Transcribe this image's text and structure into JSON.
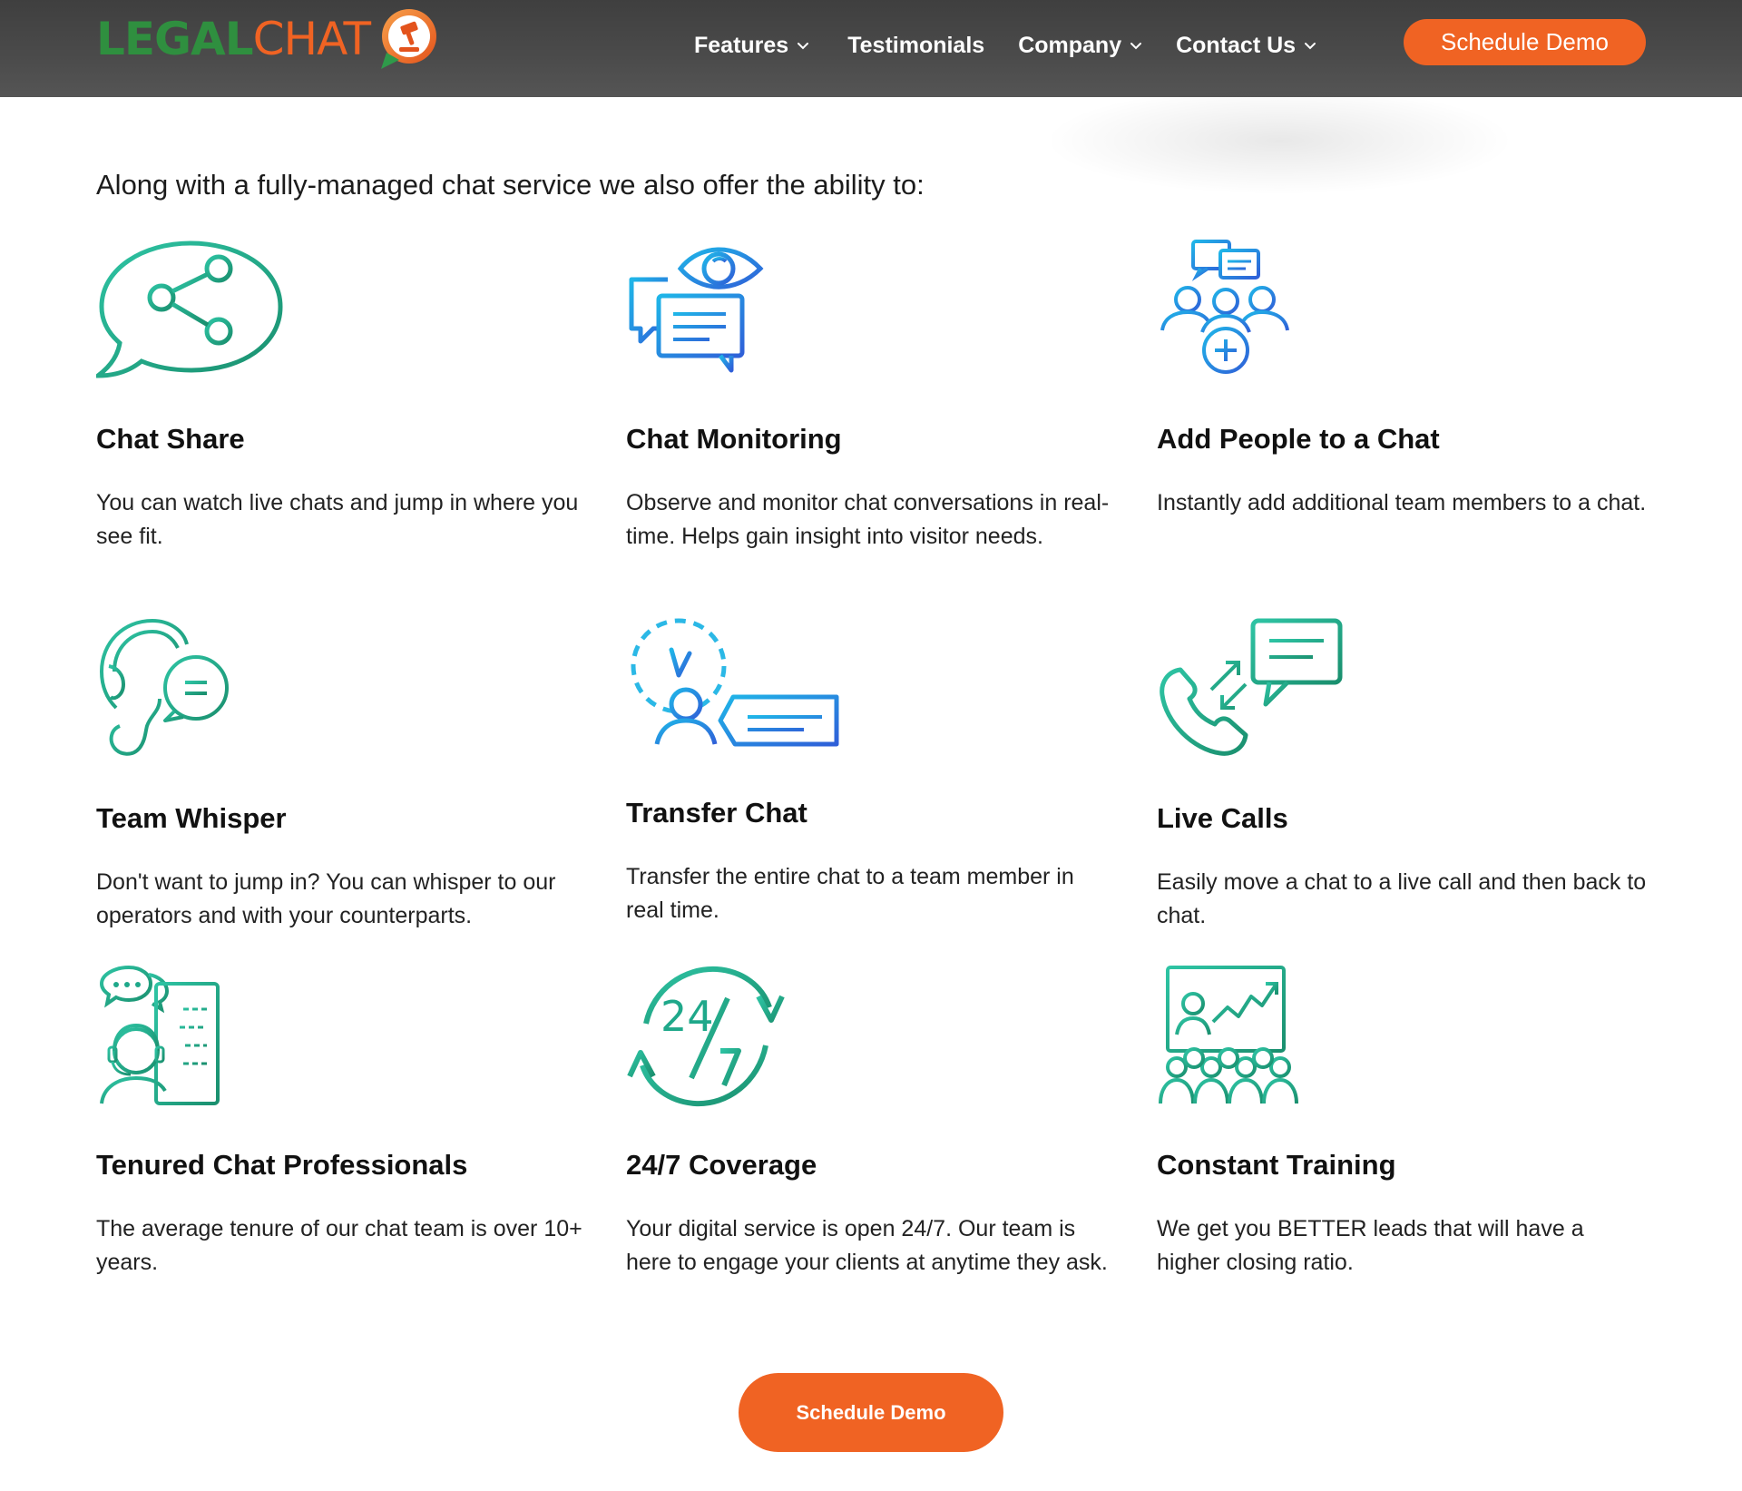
{
  "header": {
    "logo": {
      "part1": "LEGAL",
      "part2": "CHAT"
    },
    "nav": [
      {
        "label": "Features",
        "has_dropdown": true
      },
      {
        "label": "Testimonials",
        "has_dropdown": false
      },
      {
        "label": "Company",
        "has_dropdown": true
      },
      {
        "label": "Contact Us",
        "has_dropdown": true
      }
    ],
    "cta_label": "Schedule Demo"
  },
  "main": {
    "intro": "Along with a fully-managed chat service we also offer the ability to:",
    "features": [
      {
        "icon": "chat-share-icon",
        "title": "Chat Share",
        "description": "You can watch live chats and jump in where you see fit."
      },
      {
        "icon": "chat-monitoring-icon",
        "title": "Chat Monitoring",
        "description": "Observe and monitor chat conversations in real-time. Helps gain insight into visitor needs."
      },
      {
        "icon": "add-people-icon",
        "title": "Add People to a Chat",
        "description": "Instantly add additional team members to a chat."
      },
      {
        "icon": "team-whisper-icon",
        "title": "Team Whisper",
        "description": "Don't want to jump in? You can whisper to our operators and with your counterparts."
      },
      {
        "icon": "transfer-chat-icon",
        "title": "Transfer Chat",
        "description": "Transfer the entire chat to a team member in real time."
      },
      {
        "icon": "live-calls-icon",
        "title": "Live Calls",
        "description": "Easily move a chat to a live call and then back to chat."
      },
      {
        "icon": "chat-professional-icon",
        "title": "Tenured Chat Professionals",
        "description": "The average tenure of our chat team is over 10+ years."
      },
      {
        "icon": "coverage-24-7-icon",
        "title": "24/7 Coverage",
        "description": "Your digital service is open 24/7. Our team is here to engage your clients at anytime they ask."
      },
      {
        "icon": "training-icon",
        "title": "Constant Training",
        "description": "We get you BETTER leads that will have a higher closing ratio."
      }
    ],
    "cta_label": "Schedule Demo"
  },
  "colors": {
    "accent_orange": "#f06323",
    "brand_green": "#2f8f3f",
    "icon_teal": "#1fa88a",
    "icon_blue": "#2b6bd8",
    "header_bg": "#464646"
  }
}
